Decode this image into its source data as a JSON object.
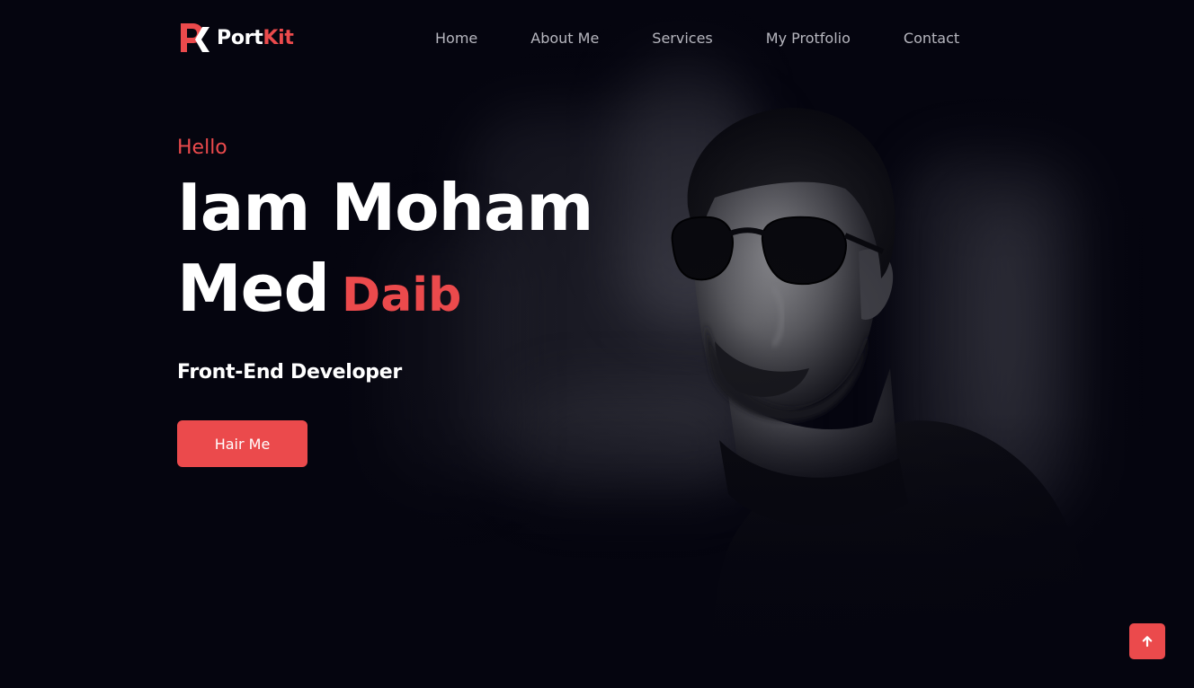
{
  "brand": {
    "name_part1": "Port",
    "name_part2": "Kit",
    "accent_color": "#eb4a4c"
  },
  "nav": {
    "items": [
      {
        "label": "Home"
      },
      {
        "label": "About Me"
      },
      {
        "label": "Services"
      },
      {
        "label": "My Protfolio"
      },
      {
        "label": "Contact"
      }
    ]
  },
  "hero": {
    "greeting": "Hello",
    "headline_line1": "Iam Moham",
    "headline_line2": "Med",
    "headline_accent": "Daib",
    "role": "Front-End Developer",
    "cta_label": "Hair Me",
    "image": "portrait-photo"
  },
  "scroll_top": {
    "icon": "arrow-up-icon"
  },
  "colors": {
    "background": "#05050f",
    "accent": "#eb4a4c",
    "nav_text": "#b7b7bf",
    "text": "#ffffff"
  }
}
